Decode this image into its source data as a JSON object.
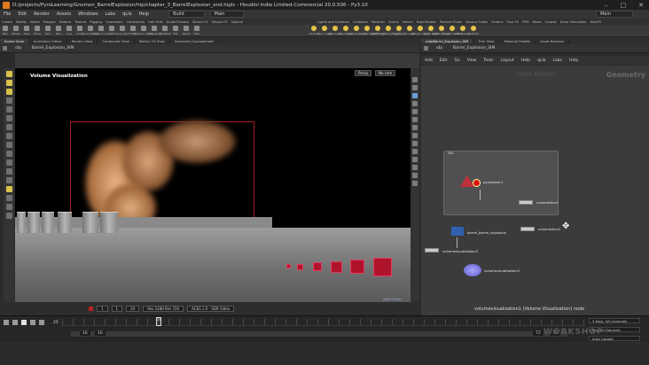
{
  "window": {
    "title": "D:/projects/PyroLearning/Gnomon_BarrelExplosion/hip/chapter_3_BarrelExplosion_end.hiplc - Houdini Indie Limited-Commercial 20.0.506 - Py3.10",
    "controls": [
      "–",
      "□",
      "✕"
    ]
  },
  "menubar": {
    "items": [
      "File",
      "Edit",
      "Render",
      "Assets",
      "Windows",
      "Labs",
      "qLib",
      "Help"
    ],
    "build": "Build",
    "desktop": "Main",
    "main_selector": "Main"
  },
  "shelf_tabs_left": [
    "Create",
    "Modify",
    "Model",
    "Polygon",
    "Deform",
    "Texture",
    "Rigging",
    "Characters",
    "Constraints",
    "Hair Utils",
    "Guide Process",
    "Terrain FX",
    "Simple FX",
    "Volume"
  ],
  "shelf_tabs_right": [
    "Lights and Cameras",
    "Collisions",
    "Particles",
    "Grains",
    "Vellum",
    "Rigid Bodies",
    "Particle Fluids",
    "Viscous Fluids",
    "Oceans",
    "Pyro FX",
    "FEM",
    "Wires",
    "Crowds",
    "Drive Simulation",
    "KineFX"
  ],
  "shelf_tools_left": [
    "Box",
    "Sphere",
    "Tube",
    "Torus",
    "Grid",
    "Null",
    "Line",
    "Circle",
    "Curve Bezier",
    "Draw Curve",
    "Path",
    "Spray Paint",
    "Text",
    "Platonic Solids",
    "L-System",
    "Metaball",
    "File",
    "Spiral",
    "Helix"
  ],
  "shelf_tools_right": [
    "Camera",
    "Point Light",
    "Spot Light",
    "Area Light",
    "Geometry Light",
    "Volume Light",
    "Distant Light",
    "Environment Light",
    "Sky Light",
    "GI Light",
    "Caustic Light",
    "Portal Light",
    "Ambient Light",
    "Stereo Camera",
    "VR Camera",
    "Switcher"
  ],
  "viewer_tabs": [
    "Scene View",
    "Animation Editor",
    "Render View",
    "Composite View",
    "Motion FX View",
    "Geometry Spreadsheet"
  ],
  "network_tabs": [
    "/obj/Barrel_Explosion_SIM",
    "Tree View",
    "Material Palette",
    "Asset Browser"
  ],
  "viewer_path": [
    "obj",
    "Barrel_Explosion_SIM"
  ],
  "network_path": [
    "obj",
    "Barrel_Explosion_SIM"
  ],
  "viewport": {
    "label": "Volume Visualization",
    "persp": "Persp",
    "camera": "No cam",
    "badge": "Indie Edition"
  },
  "network_menu": [
    "Add",
    "Edit",
    "Go",
    "View",
    "Tools",
    "Layout",
    "Help",
    "qLib",
    "Labs",
    "Help"
  ],
  "network_editor": {
    "type_label": "Geometry",
    "watermark": "Indie Edition",
    "netbox_title": "SIM",
    "nodes": [
      {
        "name": "pyrosolver1",
        "sub": ""
      },
      {
        "name": "volumeslice1",
        "sub": ""
      },
      {
        "name": "volumeslice2",
        "sub": ""
      },
      {
        "name": "barrel_barrel_explosion",
        "sub": ""
      },
      {
        "name": "volumevisualization2",
        "sub": ""
      },
      {
        "name": "volumevisualization3",
        "sub": ""
      }
    ],
    "status": "volumevisualization1 (Volume Visualization) node"
  },
  "viewer_bottom": {
    "frame_start": "1",
    "frame_end": "1",
    "fps": "24",
    "mem": "Res 1280 Res 720",
    "render": "ACES 1.0 - SDR Video"
  },
  "timeline": {
    "current_frame": "25",
    "playhead": "25",
    "range_start": "16",
    "range_start2": "16",
    "range_end": "72",
    "range_end2": "72"
  },
  "right_fields": [
    "3 keys, 0/0 channels",
    "Key All Channels",
    "Auto Update"
  ],
  "brand": "WORKSHOP",
  "colors": {
    "accent": "#e07a1f",
    "error": "#c0303a",
    "red_box": "#b0142c",
    "vis_node": "#6d6bd6"
  }
}
